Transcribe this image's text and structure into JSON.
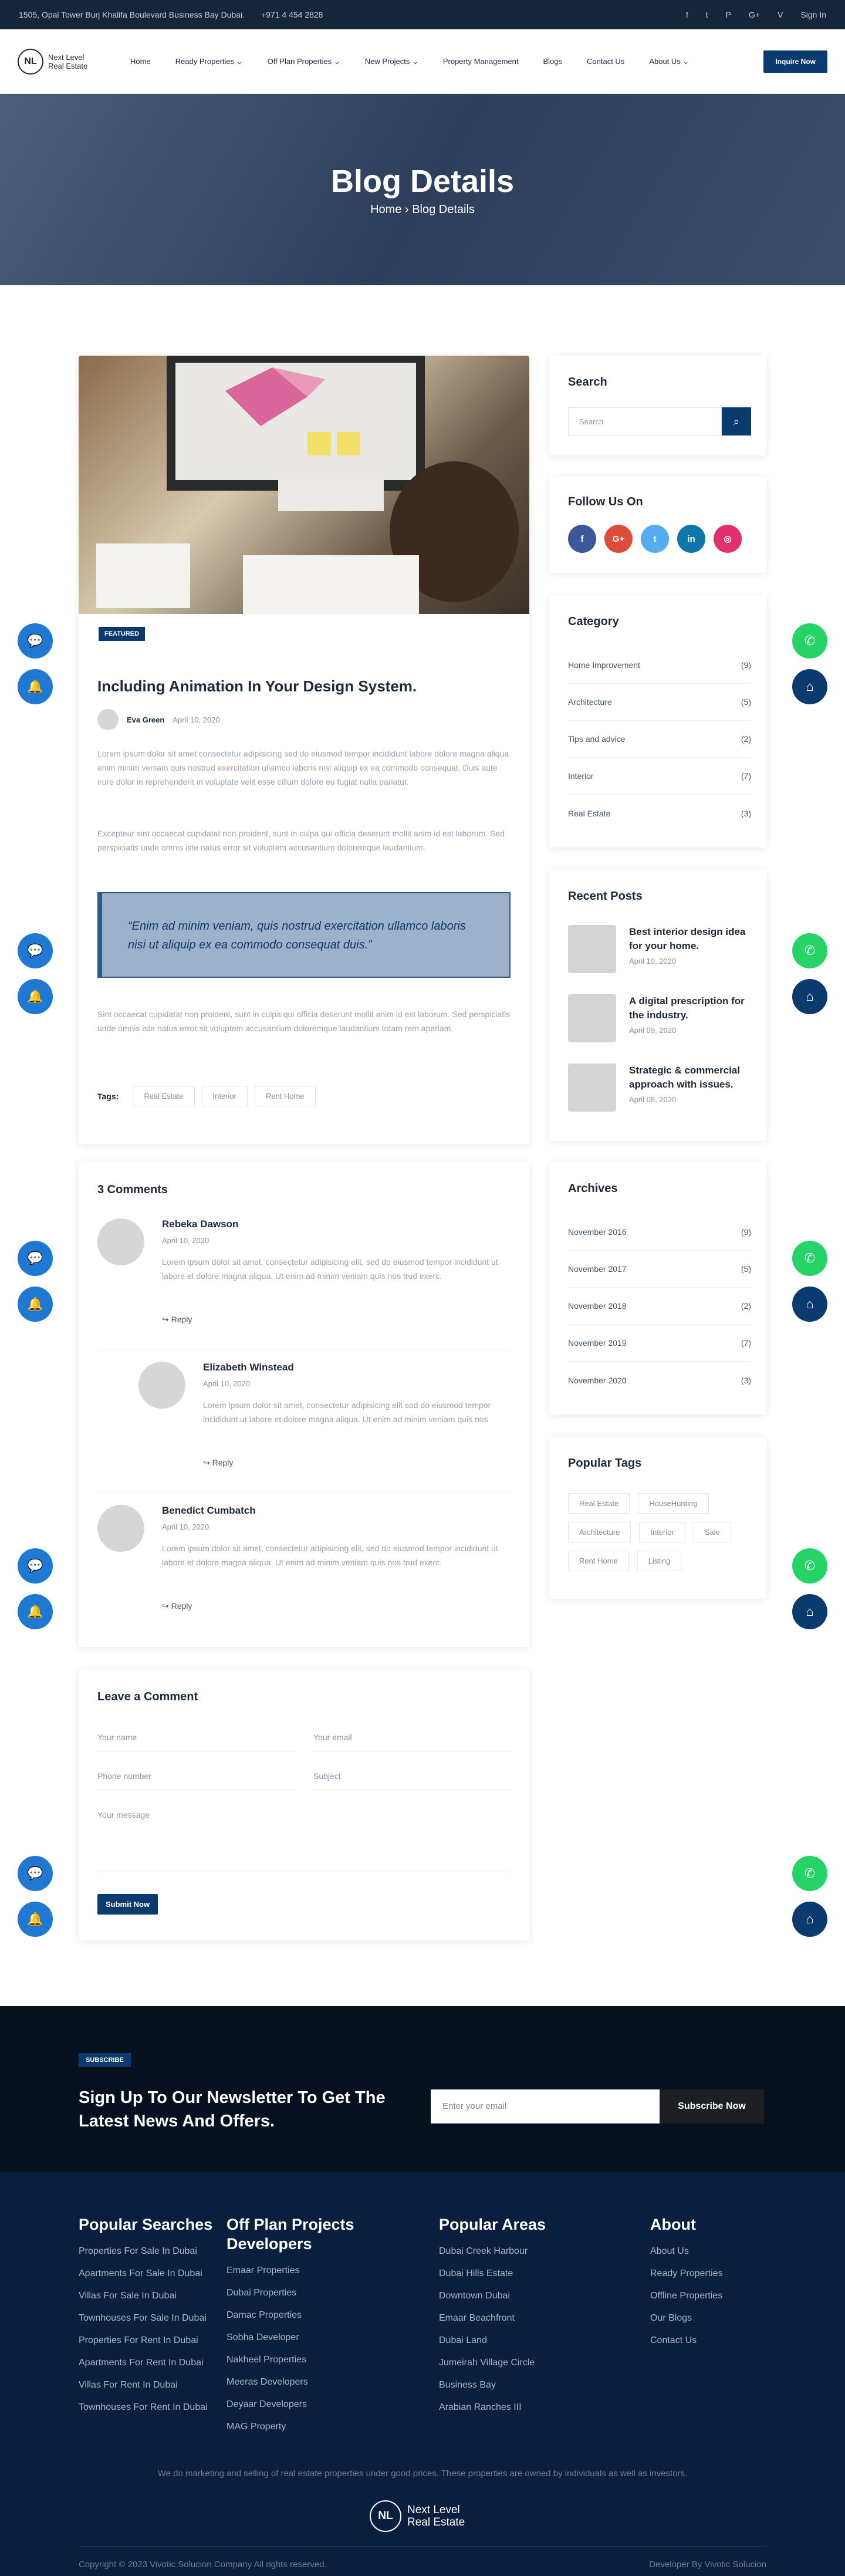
{
  "topbar": {
    "address": "1505, Opal Tower Burj Khalifa Boulevard Business Bay Dubai.",
    "phone": "+971 4 454 2828",
    "social": [
      "f",
      "t",
      "P",
      "G+",
      "V"
    ],
    "signin": "Sign In"
  },
  "nav": {
    "logo_line1": "Next Level",
    "logo_line2": "Real Estate",
    "logo_mark": "NL",
    "items": [
      "Home",
      "Ready Properties ⌄",
      "Off Plan Properties ⌄",
      "New Projects ⌄",
      "Property Management",
      "Blogs",
      "Contact Us",
      "About Us ⌄"
    ],
    "cta": "Inquire Now"
  },
  "hero": {
    "title": "Blog Details",
    "crumb_home": "Home",
    "crumb_sep": "›",
    "crumb_current": "Blog Details"
  },
  "post": {
    "badge": "FEATURED",
    "title": "Including Animation In Your Design System.",
    "author": "Eva Green",
    "date": "April 10, 2020",
    "p1": "Lorem ipsum dolor sit amet consectetur adipisicing sed do eiusmod tempor incididunt labore dolore magna aliqua enim minim veniam quis nostrud exercitation ullamco laboris nisi aliquip ex ea commodo consequat. Duis aute irure dolor in reprehenderit in voluptate velit esse cillum dolore eu fugiat nulla pariatur.",
    "p2": "Excepteur sint occaecat cupidatat non proident, sunt in culpa qui officia deserunt mollit anim id est laborum. Sed perspiciatis unde omnis iste natus error sit voluptem accusantium doloremque laudantium.",
    "quote": "“Enim ad minim veniam, quis nostrud exercitation ullamco laboris nisi ut aliquip ex ea commodo consequat duis.”",
    "p3": "Sint occaecat cupidatat non proident, sunt in culpa qui officia deserunt mollit anim id est laborum. Sed perspiciatis unde omnis iste natus error sit voluptem accusantium doloremque laudantium totam rem aperiam.",
    "tags_label": "Tags:",
    "tags": [
      "Real Estate",
      "Interior",
      "Rent Home"
    ]
  },
  "comments": {
    "heading": "3 Comments",
    "items": [
      {
        "name": "Rebeka Dawson",
        "date": "April 10, 2020",
        "text": "Lorem ipsum dolor sit amet, consectetur adipisicing elit, sed do eiusmod tempor incididunt ut labore et dolore magna aliqua. Ut enim ad minim veniam quis nos trud exerc.",
        "reply": "↪ Reply"
      },
      {
        "name": "Elizabeth Winstead",
        "date": "April 10, 2020",
        "text": "Lorem ipsum dolor sit amet, consectetur adipisicing elit sed do eiusmod tempor incididunt ut labore et dolore magna aliqua. Ut enim ad minim veniam quis nos",
        "reply": "↪ Reply"
      },
      {
        "name": "Benedict Cumbatch",
        "date": "April 10, 2020",
        "text": "Lorem ipsum dolor sit amet, consectetur adipisicing elit, sed do eiusmod tempor incididunt ut labore et dolore magna aliqua. Ut enim ad minim veniam quis nos trud exerc.",
        "reply": "↪ Reply"
      }
    ]
  },
  "form": {
    "heading": "Leave a Comment",
    "name": "Your name",
    "email": "Your email",
    "phone": "Phone number",
    "subject": "Subject",
    "message": "Your message",
    "submit": "Submit Now"
  },
  "sidebar": {
    "search_title": "Search",
    "search_placeholder": "Search",
    "follow_title": "Follow Us On",
    "social": [
      "f",
      "G+",
      "t",
      "in",
      "◎"
    ],
    "cat_title": "Category",
    "categories": [
      {
        "n": "Home Improvement",
        "c": "(9)"
      },
      {
        "n": "Architecture",
        "c": "(5)"
      },
      {
        "n": "Tips and advice",
        "c": "(2)"
      },
      {
        "n": "Interior",
        "c": "(7)"
      },
      {
        "n": "Real Estate",
        "c": "(3)"
      }
    ],
    "recent_title": "Recent Posts",
    "recent": [
      {
        "t": "Best interior design idea for your home.",
        "d": "April 10, 2020"
      },
      {
        "t": "A digital prescription for the industry.",
        "d": "April 09, 2020"
      },
      {
        "t": "Strategic & commercial approach with issues.",
        "d": "April 08, 2020"
      }
    ],
    "archives_title": "Archives",
    "archives": [
      {
        "n": "November 2016",
        "c": "(9)"
      },
      {
        "n": "November 2017",
        "c": "(5)"
      },
      {
        "n": "November 2018",
        "c": "(2)"
      },
      {
        "n": "November 2019",
        "c": "(7)"
      },
      {
        "n": "November 2020",
        "c": "(3)"
      }
    ],
    "tags_title": "Popular Tags",
    "tags": [
      "Real Estate",
      "HouseHunting",
      "Architecture",
      "Interior",
      "Sale",
      "Rent Home",
      "Listing"
    ]
  },
  "footer": {
    "sub_badge": "SUBSCRIBE",
    "news_title": "Sign Up To Our Newsletter To Get The Latest News And Offers.",
    "email_ph": "Enter your email",
    "sub_btn": "Subscribe Now",
    "col1_title": "Popular Searches",
    "col1": [
      "Properties For Sale In Dubai",
      "Apartments For Sale In Dubai",
      "Villas For Sale In Dubai",
      "Townhouses For Sale In Dubai",
      "Properties For Rent In Dubai",
      "Apartments For Rent In Dubai",
      "Villas For Rent In Dubai",
      "Townhouses For Rent In Dubai"
    ],
    "col2_title": "Off Plan Projects Developers",
    "col2": [
      "Emaar Properties",
      "Dubai Properties",
      "Damac Properties",
      "Sobha Developer",
      "Nakheel Properties",
      "Meeras Developers",
      "Deyaar Developers",
      "MAG Property"
    ],
    "col3_title": "Popular Areas",
    "col3": [
      "Dubai Creek Harbour",
      "Dubai Hills Estate",
      "Downtown Dubai",
      "Emaar Beachfront",
      "Dubai Land",
      "Jumeirah Village Circle",
      "Business Bay",
      "Arabian Ranches III"
    ],
    "col4_title": "About",
    "col4": [
      "About Us",
      "Ready Properties",
      "Offline Properties",
      "Our Blogs",
      "Contact Us"
    ],
    "disclaimer": "We do marketing and selling of real estate properties under good prices. These properties are owned by individuals as well as investors.",
    "copyright": "Copyright © 2023 Vivotic Solucion Company All rights reserved.",
    "developer": "Developer By Vivotic Solucion"
  }
}
